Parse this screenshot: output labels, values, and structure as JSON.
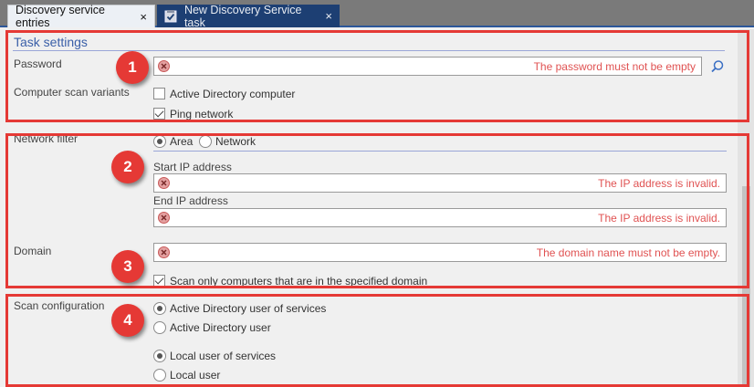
{
  "tabs": [
    {
      "label": "Discovery service entries",
      "close": "×"
    },
    {
      "label": "New Discovery Service task",
      "close": "×"
    }
  ],
  "task_settings": {
    "title": "Task settings",
    "password_label": "Password",
    "password_error": "The password must not be empty",
    "scan_variants_label": "Computer scan variants",
    "option_ad_computer": "Active Directory computer",
    "option_ad_computer_checked": false,
    "option_ping_network": "Ping network",
    "option_ping_network_checked": true
  },
  "network_filter": {
    "label": "Network filter",
    "radio_area": "Area",
    "radio_area_selected": true,
    "radio_network": "Network",
    "start_ip_label": "Start IP address",
    "start_ip_error": "The IP address is invalid.",
    "end_ip_label": "End IP address",
    "end_ip_error": "The IP address is invalid.",
    "domain_label": "Domain",
    "domain_error": "The domain name must not be empty.",
    "scan_only_domain": "Scan only computers that are in the specified domain",
    "scan_only_domain_checked": true
  },
  "scan_configuration": {
    "label": "Scan configuration",
    "option_ad_user_services": "Active Directory user of services",
    "option_ad_user": "Active Directory user",
    "option_local_user_services": "Local user of services",
    "option_local_user": "Local user"
  },
  "badges": [
    "1",
    "2",
    "3",
    "4"
  ],
  "colors": {
    "highlight_red": "#e53935",
    "error_text": "#e05252",
    "tab_active_bg": "#1d3f73",
    "section_title": "#3a5fa8"
  }
}
